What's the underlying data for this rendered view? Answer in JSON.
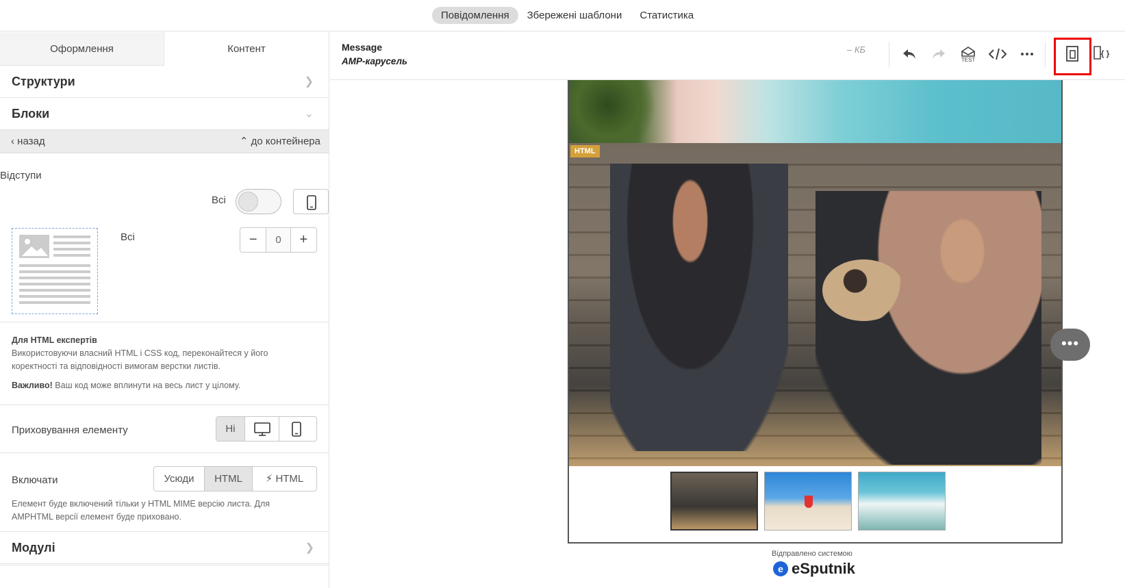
{
  "topnav": {
    "tabs": [
      {
        "label": "Повідомлення",
        "active": true
      },
      {
        "label": "Збережені шаблони",
        "active": false
      },
      {
        "label": "Статистика",
        "active": false
      }
    ]
  },
  "left_panel": {
    "tabs": [
      {
        "label": "Оформлення",
        "active": false
      },
      {
        "label": "Контент",
        "active": true
      }
    ],
    "sections": {
      "structures": "Структури",
      "blocks": "Блоки",
      "modules": "Модулі"
    },
    "nav": {
      "back": "назад",
      "to_container": "до контейнера"
    },
    "paddings": {
      "title": "Відступи",
      "all_toggle_label": "Всі",
      "all_label": "Всі",
      "value": "0"
    },
    "html_experts": {
      "title": "Для HTML експертів",
      "text": "Використовуючи власний HTML і CSS код, переконайтеся у його коректності та відповідності вимогам верстки листів.",
      "important_label": "Важливо!",
      "important_text": "Ваш код може вплинути на весь лист у цілому."
    },
    "hide_element": {
      "label": "Приховування елементу",
      "options": [
        "Ні"
      ],
      "selected": "Ні"
    },
    "include": {
      "label": "Включати",
      "options": [
        "Усюди",
        "HTML",
        "HTML"
      ],
      "selected": "HTML",
      "note": "Елемент буде включений тільки у HTML MIME версію листа. Для AMPHTML версії елемент буде приховано."
    }
  },
  "main_header": {
    "title": "Message",
    "subtitle": "AMP-карусель",
    "size": "– КБ",
    "test_label": "TEST"
  },
  "email": {
    "html_tag": "HTML",
    "sent_by": "Відправлено системою",
    "brand": "eSputnik",
    "more_button": "•••"
  },
  "colors": {
    "accent_highlight": "#e00000",
    "html_tag": "#d4a03a",
    "brand_blue": "#1e63d8"
  }
}
